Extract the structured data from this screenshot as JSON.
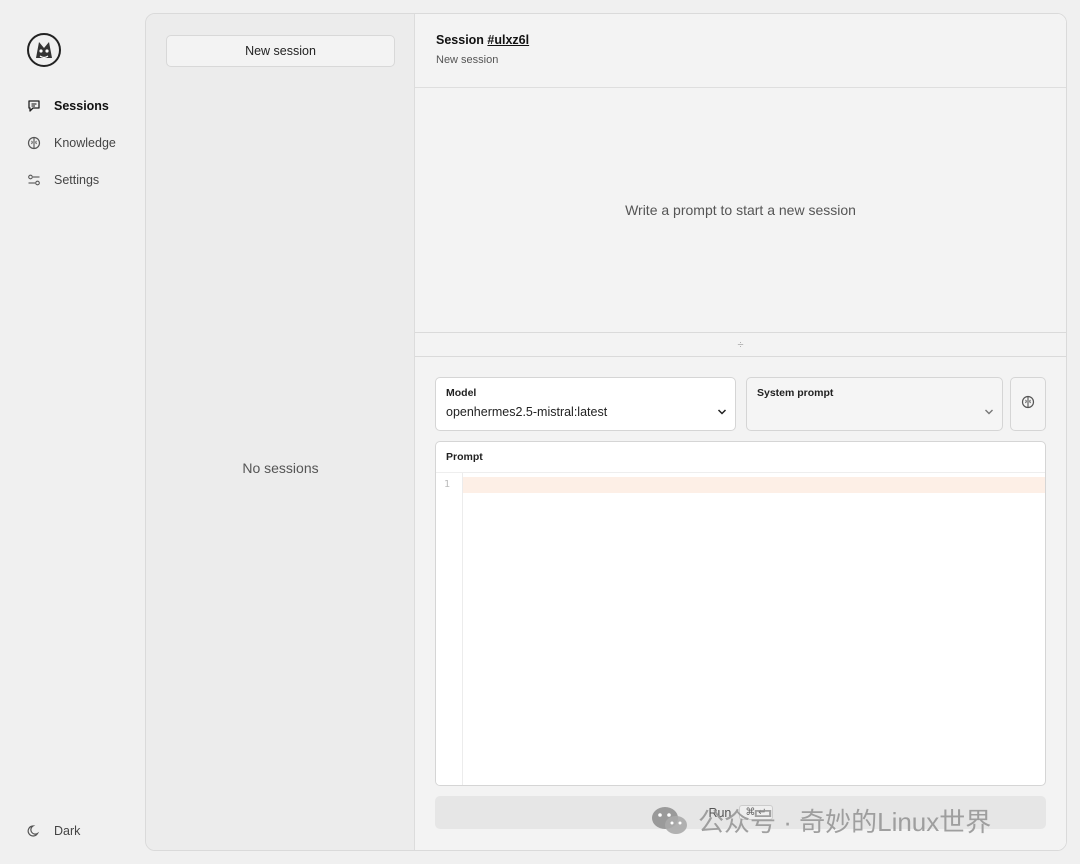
{
  "nav": {
    "items": [
      {
        "label": "Sessions",
        "icon": "chat-icon"
      },
      {
        "label": "Knowledge",
        "icon": "brain-icon"
      },
      {
        "label": "Settings",
        "icon": "sliders-icon"
      }
    ],
    "theme_toggle": {
      "label": "Dark",
      "icon": "moon-icon"
    }
  },
  "sessions": {
    "new_button": "New session",
    "empty": "No sessions"
  },
  "session": {
    "title_prefix": "Session",
    "id": "#ulxz6l",
    "subtitle": "New session",
    "empty_message": "Write a prompt to start a new session",
    "divider_glyph": "÷"
  },
  "form": {
    "model": {
      "label": "Model",
      "value": "openhermes2.5-mistral:latest"
    },
    "system_prompt": {
      "label": "System prompt",
      "value": ""
    },
    "prompt": {
      "label": "Prompt",
      "line_number": "1"
    },
    "run": {
      "label": "Run",
      "shortcut": "⌘ ↵"
    }
  },
  "watermark": "公众号 · 奇妙的Linux世界",
  "colors": {
    "background": "#f0f0f0",
    "active_line": "#fdefe6",
    "panel": "#f3f3f3"
  }
}
